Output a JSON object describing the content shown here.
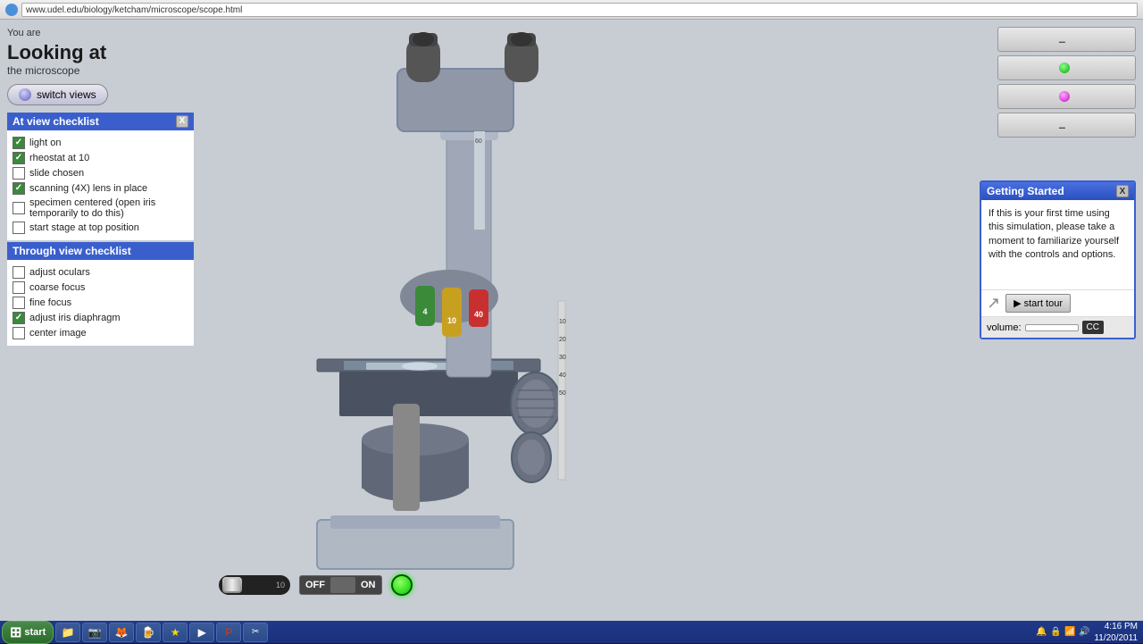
{
  "browser": {
    "url": "www.udel.edu/biology/ketcham/microscope/scope.html",
    "icon": "🌐"
  },
  "header": {
    "you_are": "You are",
    "looking_at": "Looking at",
    "the_microscope": "the microscope",
    "switch_views": "switch views"
  },
  "at_view_checklist": {
    "title": "At view checklist",
    "close": "X",
    "items": [
      {
        "label": "light on",
        "checked": true
      },
      {
        "label": "rheostat at 10",
        "checked": true
      },
      {
        "label": "slide chosen",
        "checked": false
      },
      {
        "label": "scanning (4X) lens in place",
        "checked": true
      },
      {
        "label": "specimen centered (open iris temporarily to do this)",
        "checked": false
      },
      {
        "label": "start stage at top position",
        "checked": false
      }
    ]
  },
  "through_view_checklist": {
    "title": "Through view checklist",
    "items": [
      {
        "label": "adjust oculars",
        "checked": false
      },
      {
        "label": "coarse focus",
        "checked": false
      },
      {
        "label": "fine focus",
        "checked": false
      },
      {
        "label": "adjust iris diaphragm",
        "checked": true
      },
      {
        "label": "center image",
        "checked": false
      }
    ]
  },
  "control_buttons": [
    {
      "label": "-",
      "indicator": "dash",
      "id": "btn1"
    },
    {
      "label": "",
      "indicator": "green",
      "id": "btn2"
    },
    {
      "label": "-",
      "indicator": "pink",
      "id": "btn3"
    },
    {
      "label": "-",
      "indicator": "dash2",
      "id": "btn4"
    }
  ],
  "getting_started": {
    "title": "Getting Started",
    "close": "X",
    "body": "If this  is your first time using this simulation, please take a moment to familiarize yourself with the controls and options.",
    "start_tour": "▶ start tour",
    "volume_label": "volume:",
    "cc_label": "CC"
  },
  "bottom_controls": {
    "off_label": "OFF",
    "on_label": "ON"
  },
  "taskbar": {
    "start_label": "start",
    "time": "4:16 PM",
    "date": "11/20/2011"
  }
}
